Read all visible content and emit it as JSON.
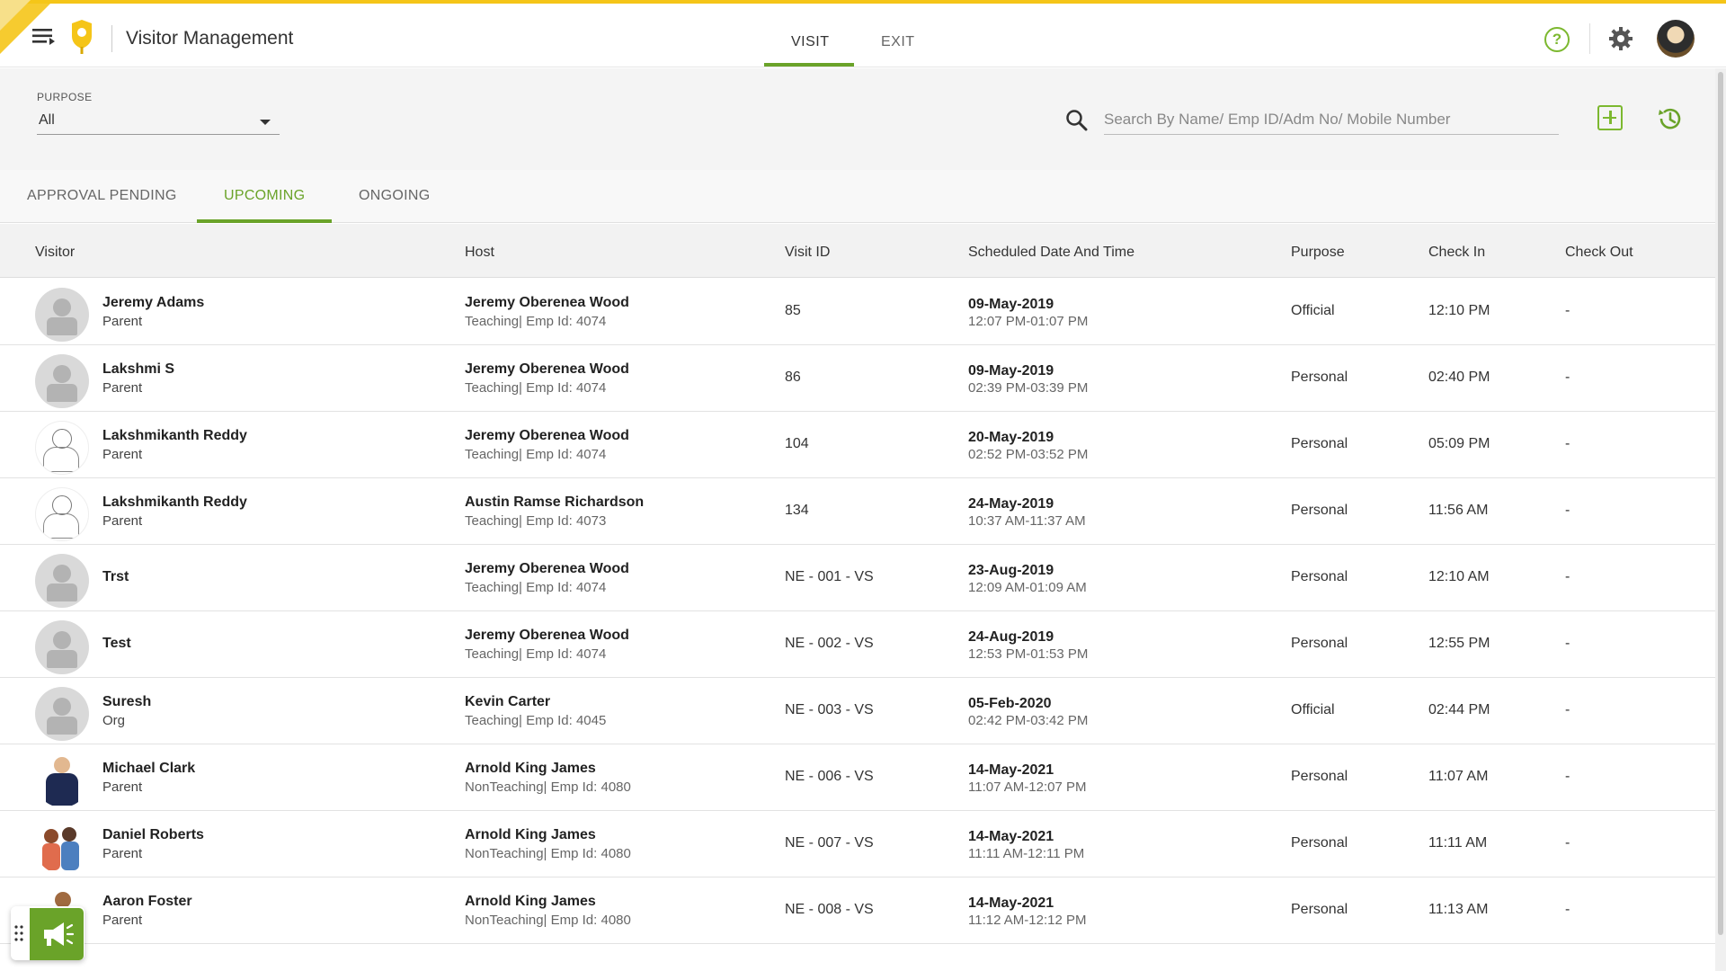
{
  "app": {
    "title": "Visitor Management"
  },
  "top_tabs": [
    {
      "label": "VISIT",
      "active": true
    },
    {
      "label": "EXIT",
      "active": false
    }
  ],
  "filter": {
    "purpose_label": "PURPOSE",
    "purpose_value": "All",
    "search_placeholder": "Search By Name/ Emp ID/Adm No/ Mobile Number"
  },
  "sub_tabs": [
    {
      "label": "APPROVAL PENDING",
      "active": false
    },
    {
      "label": "UPCOMING",
      "active": true
    },
    {
      "label": "ONGOING",
      "active": false
    }
  ],
  "table": {
    "columns": [
      "Visitor",
      "Host",
      "Visit ID",
      "Scheduled Date And Time",
      "Purpose",
      "Check In",
      "Check Out"
    ],
    "rows": [
      {
        "avatar": "generic",
        "name": "Jeremy Adams",
        "role": "Parent",
        "host": "Jeremy Oberenea Wood",
        "host_sub": "Teaching| Emp Id: 4074",
        "visit_id": "85",
        "date": "09-May-2019",
        "time": "12:07 PM-01:07 PM",
        "purpose": "Official",
        "check_in": "12:10 PM",
        "check_out": "-"
      },
      {
        "avatar": "generic",
        "name": "Lakshmi S",
        "role": "Parent",
        "host": "Jeremy Oberenea Wood",
        "host_sub": "Teaching| Emp Id: 4074",
        "visit_id": "86",
        "date": "09-May-2019",
        "time": "02:39 PM-03:39 PM",
        "purpose": "Personal",
        "check_in": "02:40 PM",
        "check_out": "-"
      },
      {
        "avatar": "sketch",
        "name": "Lakshmikanth Reddy",
        "role": "Parent",
        "host": "Jeremy Oberenea Wood",
        "host_sub": "Teaching| Emp Id: 4074",
        "visit_id": "104",
        "date": "20-May-2019",
        "time": "02:52 PM-03:52 PM",
        "purpose": "Personal",
        "check_in": "05:09 PM",
        "check_out": "-"
      },
      {
        "avatar": "sketch",
        "name": "Lakshmikanth Reddy",
        "role": "Parent",
        "host": "Austin Ramse Richardson",
        "host_sub": "Teaching| Emp Id: 4073",
        "visit_id": "134",
        "date": "24-May-2019",
        "time": "10:37 AM-11:37 AM",
        "purpose": "Personal",
        "check_in": "11:56 AM",
        "check_out": "-"
      },
      {
        "avatar": "generic",
        "name": "Trst",
        "role": "",
        "host": "Jeremy Oberenea Wood",
        "host_sub": "Teaching| Emp Id: 4074",
        "visit_id": "NE - 001 - VS",
        "date": "23-Aug-2019",
        "time": "12:09 AM-01:09 AM",
        "purpose": "Personal",
        "check_in": "12:10 AM",
        "check_out": "-"
      },
      {
        "avatar": "generic",
        "name": "Test",
        "role": "",
        "host": "Jeremy Oberenea Wood",
        "host_sub": "Teaching| Emp Id: 4074",
        "visit_id": "NE - 002 - VS",
        "date": "24-Aug-2019",
        "time": "12:53 PM-01:53 PM",
        "purpose": "Personal",
        "check_in": "12:55 PM",
        "check_out": "-"
      },
      {
        "avatar": "generic",
        "name": "Suresh",
        "role": "Org",
        "host": "Kevin Carter",
        "host_sub": "Teaching| Emp Id: 4045",
        "visit_id": "NE - 003 - VS",
        "date": "05-Feb-2020",
        "time": "02:42 PM-03:42 PM",
        "purpose": "Official",
        "check_in": "02:44 PM",
        "check_out": "-"
      },
      {
        "avatar": "person1",
        "name": "Michael Clark",
        "role": "Parent",
        "host": "Arnold King James",
        "host_sub": "NonTeaching| Emp Id: 4080",
        "visit_id": "NE - 006 - VS",
        "date": "14-May-2021",
        "time": "11:07 AM-12:07 PM",
        "purpose": "Personal",
        "check_in": "11:07 AM",
        "check_out": "-"
      },
      {
        "avatar": "person2",
        "name": "Daniel Roberts",
        "role": "Parent",
        "host": "Arnold King James",
        "host_sub": "NonTeaching| Emp Id: 4080",
        "visit_id": "NE - 007 - VS",
        "date": "14-May-2021",
        "time": "11:11 AM-12:11 PM",
        "purpose": "Personal",
        "check_in": "11:11 AM",
        "check_out": "-"
      },
      {
        "avatar": "person3",
        "name": "Aaron Foster",
        "role": "Parent",
        "host": "Arnold King James",
        "host_sub": "NonTeaching| Emp Id: 4080",
        "visit_id": "NE - 008 - VS",
        "date": "14-May-2021",
        "time": "11:12 AM-12:12 PM",
        "purpose": "Personal",
        "check_in": "11:13 AM",
        "check_out": "-"
      }
    ]
  },
  "icons": {
    "menu": "menu-icon",
    "logo": "logo-icon",
    "help": "help-icon",
    "settings": "gear-icon",
    "search": "search-icon",
    "add": "add-visitor-icon",
    "history": "history-icon",
    "announce": "megaphone-icon"
  },
  "colors": {
    "accent_green": "#6aa329",
    "brand_yellow": "#f5c518"
  }
}
